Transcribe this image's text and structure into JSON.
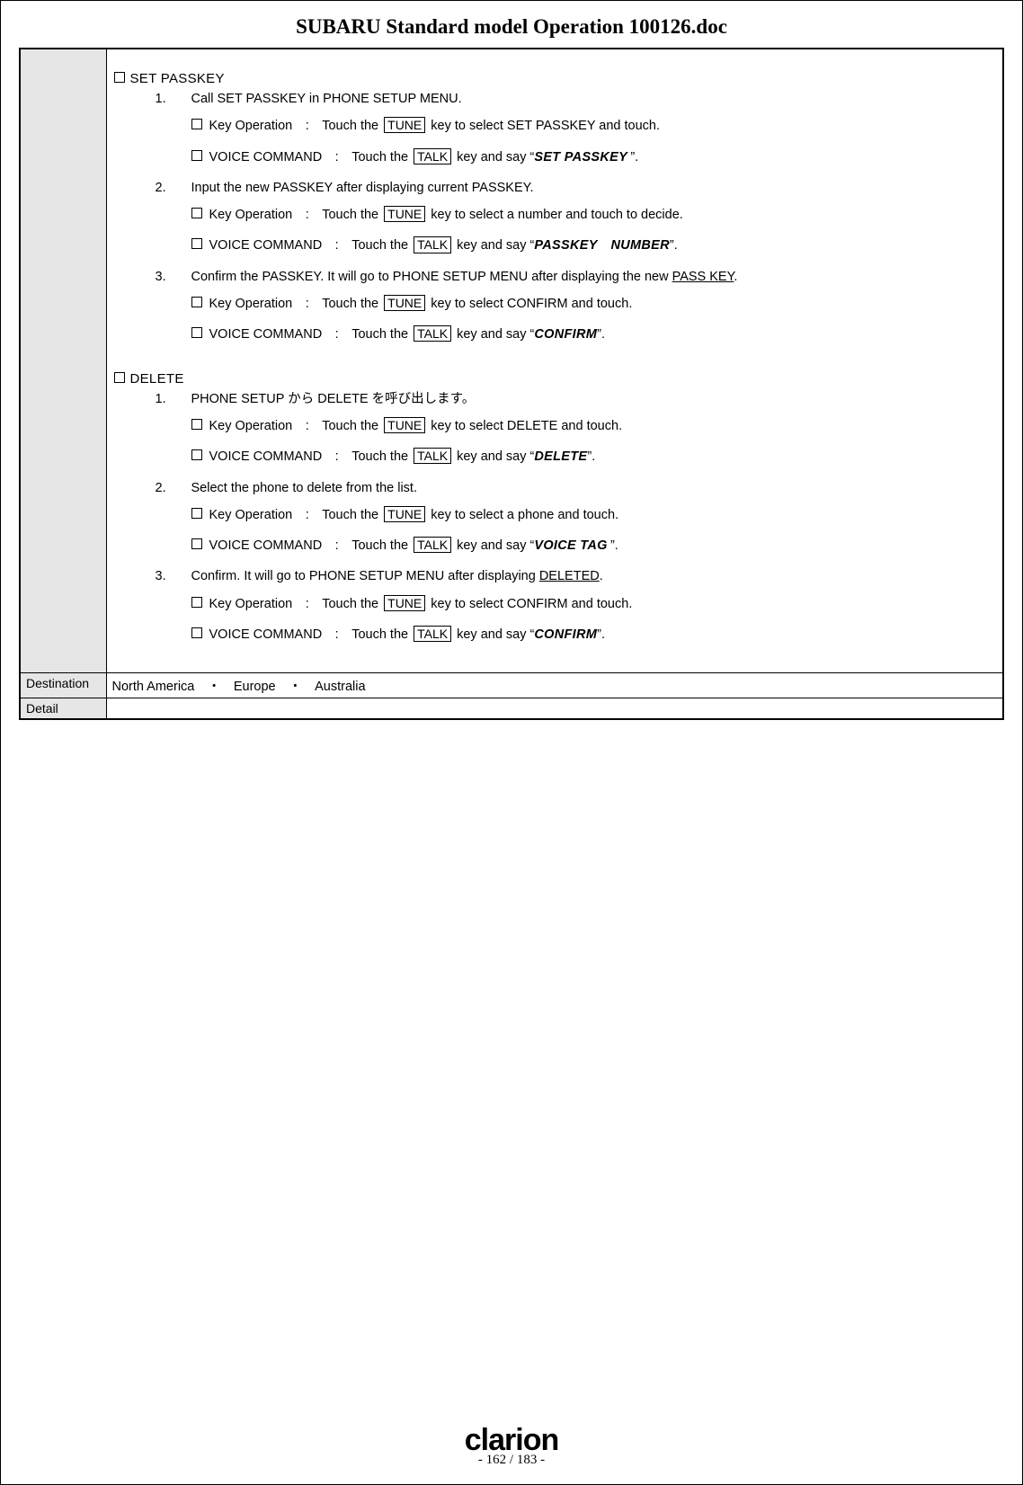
{
  "title": "SUBARU Standard model Operation 100126.doc",
  "keycaps": {
    "tune": "TUNE",
    "talk": "TALK"
  },
  "labels": {
    "keyop_prefix": "Key Operation : Touch the ",
    "voice_prefix": "VOICE COMMAND : Touch the ",
    "keyop_mid": " key to select ",
    "voice_mid": " key and say “",
    "voice_end": "”.",
    "and_touch": " and touch.",
    "and_touch_decide": " and touch to decide."
  },
  "sections": [
    {
      "title": "SET PASSKEY",
      "steps": [
        {
          "num": "1.",
          "text": "Call SET PASSKEY in PHONE SETUP MENU.",
          "keyop_target": "SET PASSKEY",
          "keyop_suffix_key": "and_touch",
          "voice_phrase": "SET PASSKEY "
        },
        {
          "num": "2.",
          "text": "Input the new PASSKEY after displaying current PASSKEY.",
          "keyop_target": "a number",
          "keyop_suffix_key": "and_touch_decide",
          "voice_phrase": "PASSKEY NUMBER"
        },
        {
          "num": "3.",
          "text_pre": "Confirm the PASSKEY. It will go to PHONE SETUP MENU after displaying the new ",
          "text_underlined": "PASS KEY",
          "text_post": ".",
          "keyop_target": "CONFIRM",
          "keyop_suffix_key": "and_touch",
          "voice_phrase": "CONFIRM"
        }
      ]
    },
    {
      "title": "DELETE",
      "steps": [
        {
          "num": "1.",
          "text": "PHONE SETUP から DELETE を呼び出します。",
          "keyop_target": "DELETE",
          "keyop_suffix_key": "and_touch",
          "voice_phrase": "DELETE"
        },
        {
          "num": "2.",
          "text": "Select the phone to delete from the list.",
          "keyop_target": "a phone",
          "keyop_suffix_key": "and_touch",
          "voice_phrase": "VOICE TAG "
        },
        {
          "num": "3.",
          "text_pre": "Confirm. It will go to PHONE SETUP MENU after displaying ",
          "text_underlined": "DELETED",
          "text_post": ".",
          "keyop_target": "CONFIRM",
          "keyop_suffix_key": "and_touch",
          "voice_phrase": "CONFIRM"
        }
      ]
    }
  ],
  "rows": {
    "destination_label": "Destination",
    "destination_value": "North America ・ Europe ・ Australia",
    "detail_label": "Detail",
    "detail_value": ""
  },
  "footer": {
    "brand": "clarion",
    "page": "- 162 / 183 -"
  }
}
